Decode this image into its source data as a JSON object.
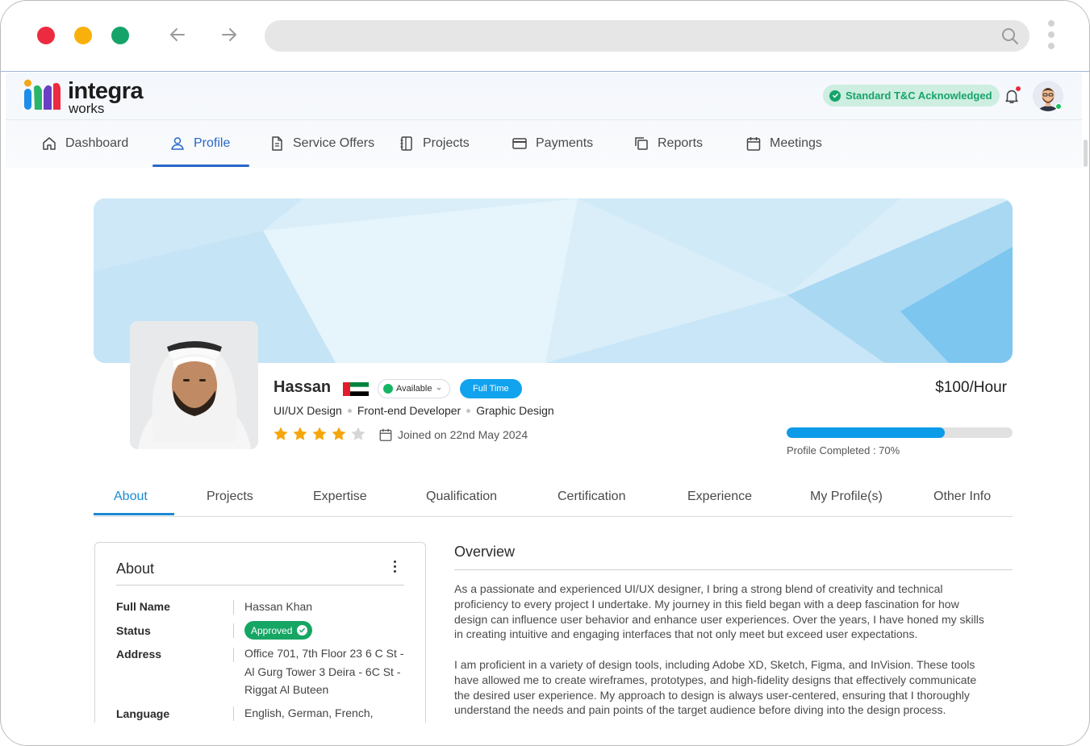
{
  "brand": {
    "name_main": "integra",
    "name_sub": "works"
  },
  "header": {
    "tc_badge": "Standard T&C Acknowledged"
  },
  "nav": [
    {
      "label": "Dashboard",
      "icon": "home-icon"
    },
    {
      "label": "Profile",
      "icon": "user-icon",
      "active": true
    },
    {
      "label": "Service Offers",
      "icon": "document-icon"
    },
    {
      "label": "Projects",
      "icon": "notebook-icon"
    },
    {
      "label": "Payments",
      "icon": "credit-card-icon"
    },
    {
      "label": "Reports",
      "icon": "copy-icon"
    },
    {
      "label": "Meetings",
      "icon": "calendar-icon"
    }
  ],
  "profile": {
    "name": "Hassan",
    "availability": "Available",
    "employment": "Full Time",
    "roles": [
      "UI/UX Design",
      "Front-end Developer",
      "Graphic Design"
    ],
    "rating": 4,
    "rating_max": 5,
    "joined": "Joined on 22nd May 2024",
    "rate": "$100/Hour",
    "completion_percent": 70,
    "completion_label": "Profile Completed : 70%"
  },
  "tabs": [
    {
      "label": "About",
      "active": true
    },
    {
      "label": "Projects"
    },
    {
      "label": "Expertise"
    },
    {
      "label": "Qualification"
    },
    {
      "label": "Certification"
    },
    {
      "label": "Experience"
    },
    {
      "label": "My Profile(s)"
    },
    {
      "label": "Other Info"
    }
  ],
  "about": {
    "title": "About",
    "full_name_label": "Full Name",
    "full_name": "Hassan Khan",
    "status_label": "Status",
    "status": "Approved",
    "address_label": "Address",
    "address_lines": [
      "Office 701, 7th Floor 23 6 C St -",
      "Al Gurg Tower 3 Deira - 6C St -",
      "Riggat Al Buteen"
    ],
    "language_label": "Language",
    "language": "English, German, French,"
  },
  "overview": {
    "title": "Overview",
    "para1_lines": [
      "As a passionate and experienced UI/UX designer, I bring a strong blend of creativity and technical",
      "proficiency to every project I undertake. My journey in this field began with a deep fascination for how",
      "design can influence user behavior and enhance user experiences. Over the years, I have honed my skills",
      "in creating intuitive and engaging interfaces that not only meet but exceed user expectations."
    ],
    "para2_lines": [
      "I am proficient in a variety of design tools, including Adobe XD, Sketch, Figma, and InVision. These tools",
      "have allowed me to create wireframes, prototypes, and high-fidelity designs that effectively communicate",
      "the desired user experience. My approach to design is always user-centered, ensuring that I thoroughly",
      "understand the needs and pain points of the target audience before diving into the design process."
    ]
  },
  "colors": {
    "accent": "#2867c9",
    "tab_accent": "#1c8ad4",
    "success": "#16a664",
    "progress": "#0b9be8"
  }
}
